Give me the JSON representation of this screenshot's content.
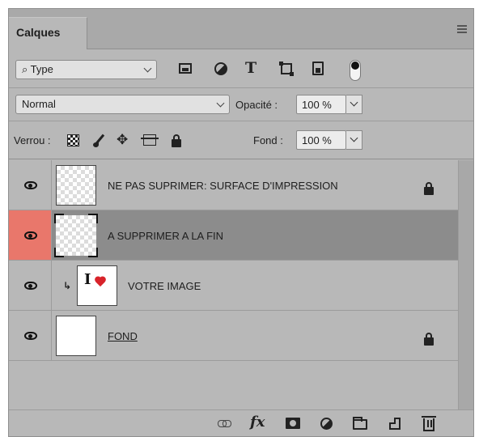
{
  "panel": {
    "tab_label": "Calques"
  },
  "filter": {
    "kind_label": "Type",
    "icons": [
      "pixel-layer-filter-icon",
      "adjustment-layer-filter-icon",
      "type-layer-filter-icon",
      "shape-layer-filter-icon",
      "smart-object-filter-icon"
    ]
  },
  "blend": {
    "mode": "Normal",
    "opacity_label": "Opacité :",
    "opacity_value": "100 %"
  },
  "lock": {
    "label": "Verrou :",
    "fill_label": "Fond :",
    "fill_value": "100 %"
  },
  "layers": [
    {
      "name": "NE PAS SUPRIMER: SURFACE D'IMPRESSION",
      "visible": true,
      "locked": true,
      "selected": false,
      "thumbnail": "transparent"
    },
    {
      "name": "A SUPPRIMER A LA FIN",
      "visible": true,
      "locked": false,
      "selected": true,
      "thumbnail": "transparent-framed"
    },
    {
      "name": "VOTRE IMAGE",
      "visible": true,
      "locked": false,
      "selected": false,
      "clipped": true,
      "thumbnail": "i-love-image"
    },
    {
      "name": "FOND",
      "visible": true,
      "locked": true,
      "selected": false,
      "thumbnail": "white"
    }
  ],
  "colors": {
    "panel_bg": "#b8b8b8",
    "selected_layer": "#8c8c8c",
    "selected_eye_bg": "#e9776b",
    "heart": "#d8232a"
  }
}
